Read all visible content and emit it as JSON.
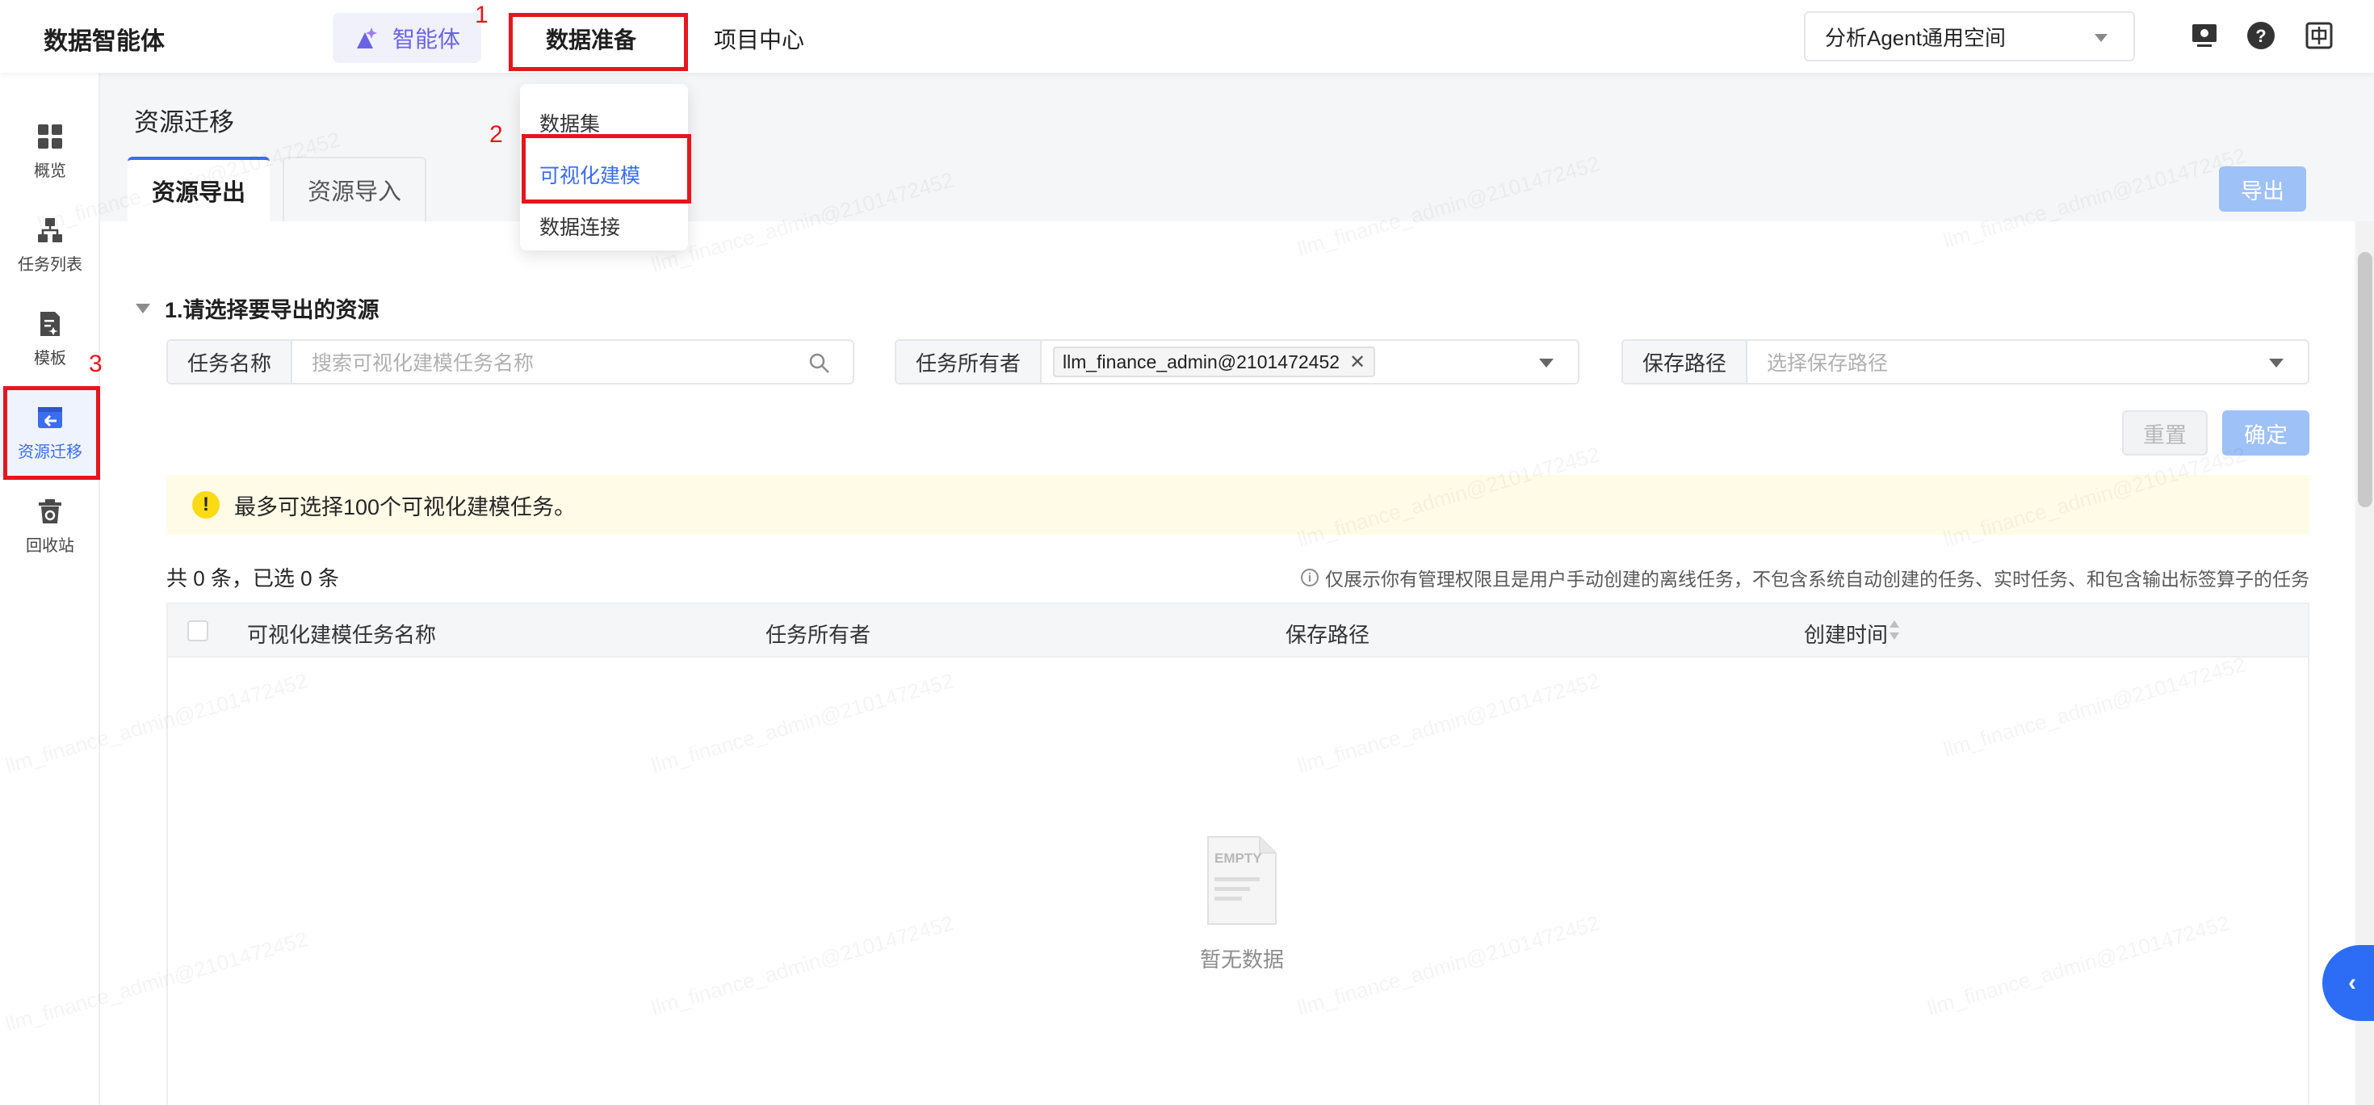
{
  "topbar": {
    "brand": "数据智能体",
    "nav_agent": "智能体",
    "nav_data": "数据准备",
    "nav_project": "项目中心",
    "space": "分析Agent通用空间"
  },
  "dropdown": {
    "items": [
      "数据集",
      "可视化建模",
      "数据连接"
    ]
  },
  "annotations": {
    "step1": "1",
    "step2": "2",
    "step3": "3"
  },
  "sidebar": {
    "items": [
      {
        "label": "概览",
        "icon": "grid-icon"
      },
      {
        "label": "任务列表",
        "icon": "hierarchy-icon"
      },
      {
        "label": "模板",
        "icon": "template-icon"
      },
      {
        "label": "资源迁移",
        "icon": "migrate-icon"
      },
      {
        "label": "回收站",
        "icon": "recycle-icon"
      }
    ]
  },
  "main": {
    "title": "资源迁移",
    "tabs": [
      "资源导出",
      "资源导入"
    ],
    "export_button": "导出",
    "section_title": "1.请选择要导出的资源",
    "filters": {
      "name_label": "任务名称",
      "name_placeholder": "搜索可视化建模任务名称",
      "owner_label": "任务所有者",
      "owner_tag": "llm_finance_admin@2101472452",
      "path_label": "保存路径",
      "path_placeholder": "选择保存路径"
    },
    "reset_button": "重置",
    "confirm_button": "确定",
    "notice": "最多可选择100个可视化建模任务。",
    "count_text": "共 0 条，已选 0 条",
    "hint": "仅展示你有管理权限且是用户手动创建的离线任务，不包含系统自动创建的任务、实时任务、和包含输出标签算子的任务",
    "table": {
      "columns": [
        "可视化建模任务名称",
        "任务所有者",
        "保存路径",
        "创建时间"
      ],
      "empty_badge": "EMPTY",
      "empty_text": "暂无数据"
    }
  },
  "watermark": "llm_finance_admin@2101472452",
  "colors": {
    "accent": "#3b6df0",
    "highlight": "#e5161d",
    "agent": "#6b63e6",
    "button_disabled": "#9ec1f7"
  }
}
